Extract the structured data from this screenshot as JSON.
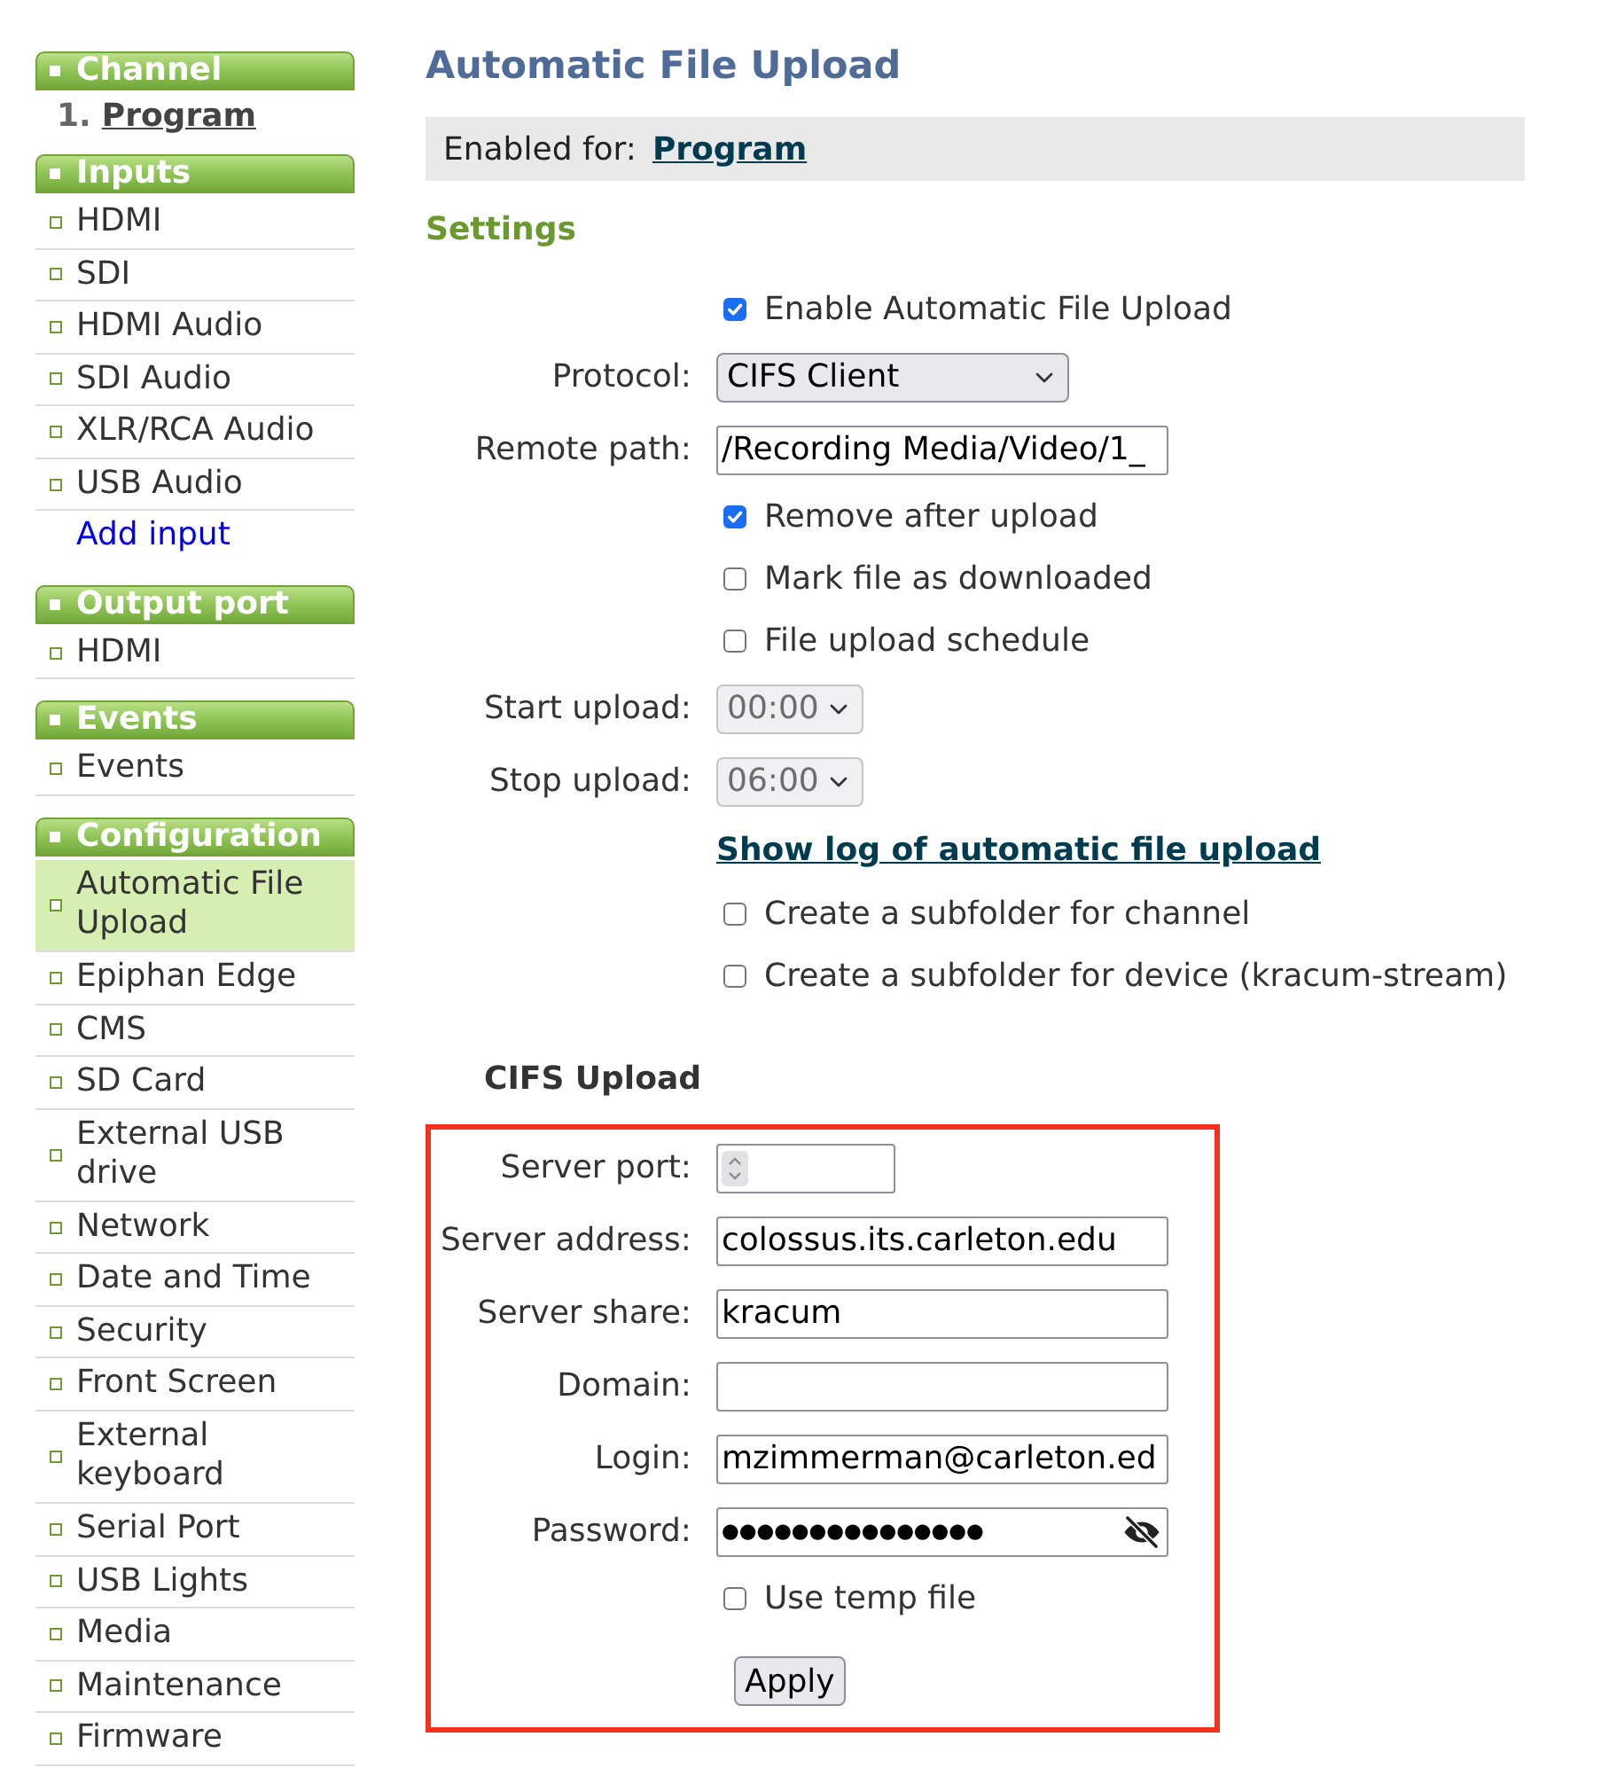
{
  "sidebar": {
    "sections": [
      {
        "title": "Channel",
        "items": [
          {
            "kind": "channel",
            "number": "1.",
            "label": "Program"
          }
        ]
      },
      {
        "title": "Inputs",
        "items": [
          {
            "kind": "page",
            "label": "HDMI",
            "selected": false
          },
          {
            "kind": "page",
            "label": "SDI",
            "selected": false
          },
          {
            "kind": "page",
            "label": "HDMI Audio",
            "selected": false
          },
          {
            "kind": "page",
            "label": "SDI Audio",
            "selected": false
          },
          {
            "kind": "page",
            "label": "XLR/RCA Audio",
            "selected": false
          },
          {
            "kind": "page",
            "label": "USB Audio",
            "selected": false
          },
          {
            "kind": "action",
            "label": "Add input",
            "selected": false
          }
        ]
      },
      {
        "title": "Output port",
        "items": [
          {
            "kind": "page",
            "label": "HDMI",
            "selected": false
          }
        ]
      },
      {
        "title": "Events",
        "items": [
          {
            "kind": "page",
            "label": "Events",
            "selected": false
          }
        ]
      },
      {
        "title": "Configuration",
        "items": [
          {
            "kind": "page",
            "label": "Automatic File Upload",
            "selected": true
          },
          {
            "kind": "page",
            "label": "Epiphan Edge",
            "selected": false
          },
          {
            "kind": "page",
            "label": "CMS",
            "selected": false
          },
          {
            "kind": "page",
            "label": "SD Card",
            "selected": false
          },
          {
            "kind": "page",
            "label": "External USB drive",
            "selected": false
          },
          {
            "kind": "page",
            "label": "Network",
            "selected": false
          },
          {
            "kind": "page",
            "label": "Date and Time",
            "selected": false
          },
          {
            "kind": "page",
            "label": "Security",
            "selected": false
          },
          {
            "kind": "page",
            "label": "Front Screen",
            "selected": false
          },
          {
            "kind": "page",
            "label": "External keyboard",
            "selected": false
          },
          {
            "kind": "page",
            "label": "Serial Port",
            "selected": false
          },
          {
            "kind": "page",
            "label": "USB Lights",
            "selected": false
          },
          {
            "kind": "page",
            "label": "Media",
            "selected": false
          },
          {
            "kind": "page",
            "label": "Maintenance",
            "selected": false
          },
          {
            "kind": "page",
            "label": "Firmware",
            "selected": false
          }
        ]
      }
    ]
  },
  "page": {
    "title": "Automatic File Upload",
    "enabled_for": {
      "label": "Enabled for:",
      "link": "Program"
    }
  },
  "settings": {
    "heading": "Settings",
    "rows": [
      {
        "kind": "checkbox",
        "label": "Enable Automatic File Upload",
        "checked": true
      },
      {
        "kind": "select",
        "label": "Protocol:",
        "value": "CIFS Client",
        "disabled": false
      },
      {
        "kind": "text",
        "label": "Remote path:",
        "value": "/Recording Media/Video/1_"
      },
      {
        "kind": "checkbox",
        "label": "Remove after upload",
        "checked": true
      },
      {
        "kind": "checkbox",
        "label": "Mark file as downloaded",
        "checked": false
      },
      {
        "kind": "checkbox",
        "label": "File upload schedule",
        "checked": false
      },
      {
        "kind": "time",
        "label": "Start upload:",
        "value": "00:00",
        "disabled": true
      },
      {
        "kind": "time",
        "label": "Stop upload:",
        "value": "06:00",
        "disabled": true
      },
      {
        "kind": "link",
        "label": "Show log of automatic file upload"
      },
      {
        "kind": "checkbox",
        "label": "Create a subfolder for channel",
        "checked": false
      },
      {
        "kind": "checkbox",
        "label": "Create a subfolder for device (kracum-stream)",
        "checked": false
      }
    ]
  },
  "cifs_upload": {
    "heading": "CIFS Upload",
    "rows": [
      {
        "kind": "number",
        "label": "Server port:"
      },
      {
        "kind": "text",
        "label": "Server address:",
        "value": "colossus.its.carleton.edu"
      },
      {
        "kind": "text",
        "label": "Server share:",
        "value": "kracum"
      },
      {
        "kind": "text",
        "label": "Domain:"
      },
      {
        "kind": "text",
        "label": "Login:",
        "value": "mzimmerman@carleton.ed"
      },
      {
        "kind": "password",
        "label": "Password:",
        "value": "●●●●●●●●●●●●●●●"
      },
      {
        "kind": "checkbox",
        "label": "Use temp file",
        "checked": false
      }
    ],
    "button": "Apply"
  }
}
